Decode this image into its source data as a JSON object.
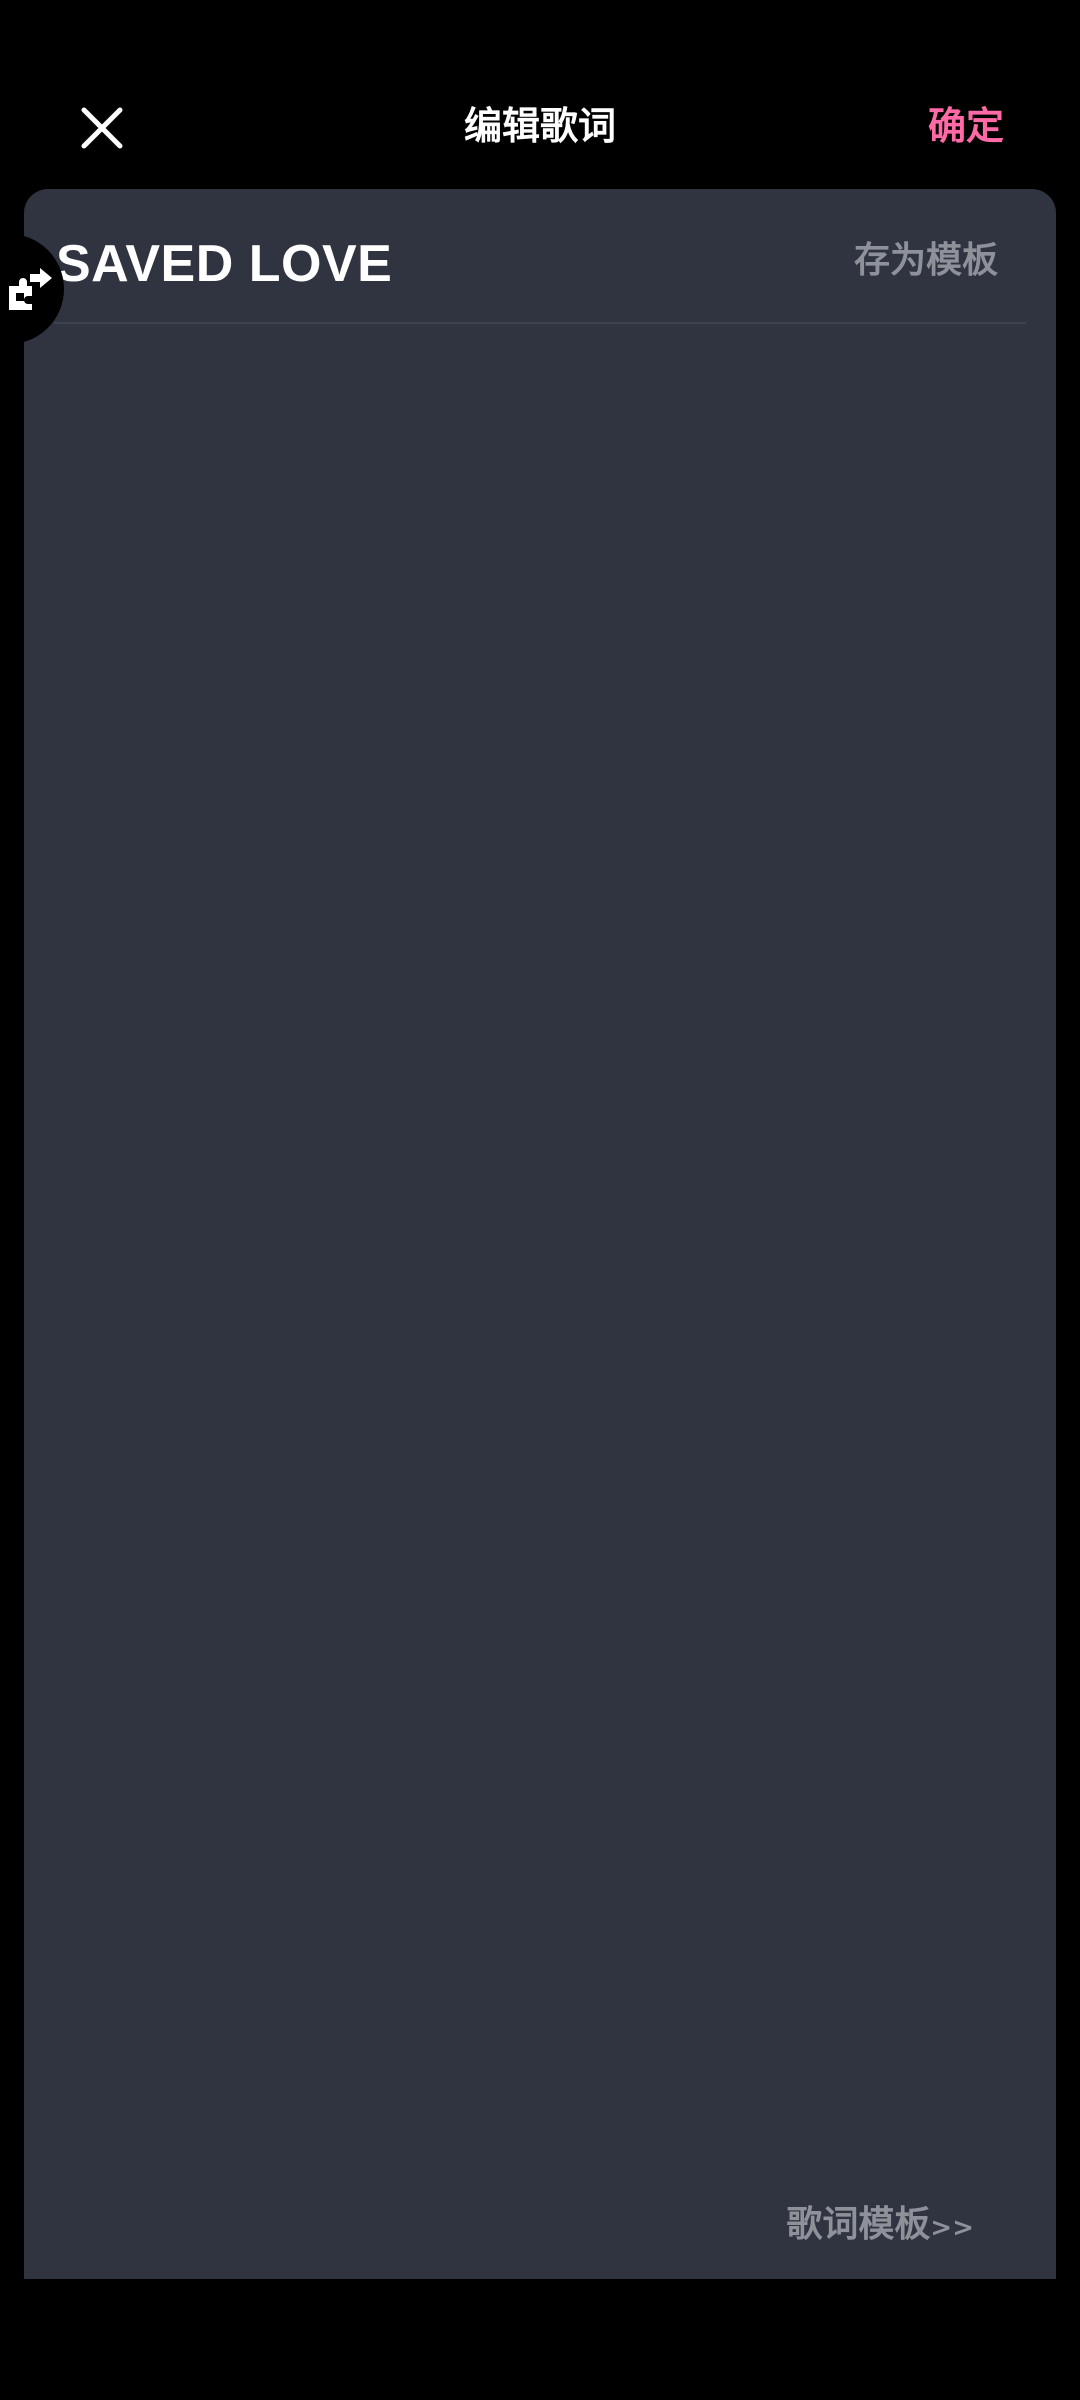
{
  "header": {
    "title": "编辑歌词",
    "confirm_label": "确定",
    "close_icon": "close-icon"
  },
  "editor": {
    "song_title": "SAVED LOVE",
    "save_template_label": "存为模板",
    "lyrics_value": "",
    "lyrics_template_label": "歌词模板",
    "lyrics_template_arrows": ">>"
  },
  "floating_tool": {
    "icon": "puzzle-swap-icon"
  },
  "colors": {
    "background": "#000000",
    "panel": "#303340",
    "accent": "#ff6aa6",
    "muted_text": "#8e909a",
    "primary_text": "#ffffff"
  }
}
